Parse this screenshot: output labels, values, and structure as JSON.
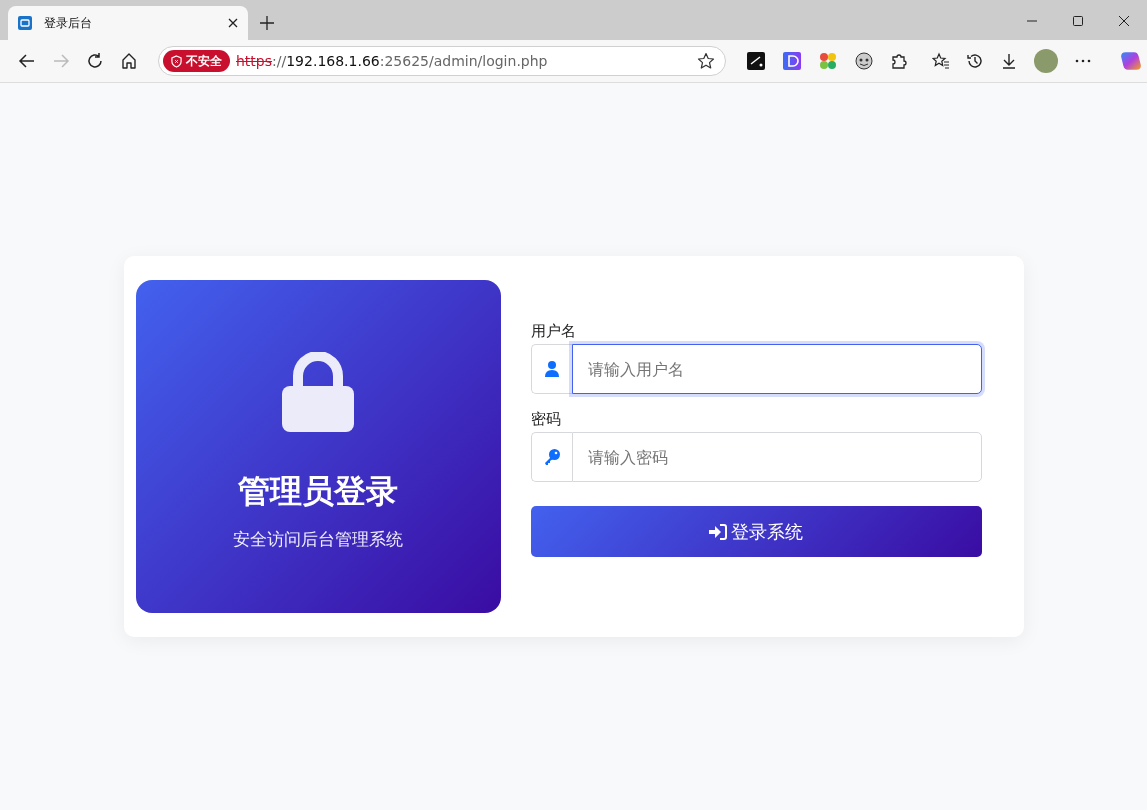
{
  "browser": {
    "tab": {
      "title": "登录后台",
      "selected": true
    },
    "security_badge": "不安全",
    "address": {
      "scheme": "https",
      "separator": "://",
      "host": "192.168.1.66",
      "path": ":25625/admin/login.php"
    }
  },
  "hero": {
    "title": "管理员登录",
    "subtitle": "安全访问后台管理系统"
  },
  "fields": [
    {
      "kind": "user",
      "label": "用户名",
      "placeholder": "请输入用户名",
      "focused": true
    },
    {
      "kind": "password",
      "label": "密码",
      "placeholder": "请输入密码",
      "focused": false
    }
  ],
  "submit": {
    "label": "登录系统"
  }
}
